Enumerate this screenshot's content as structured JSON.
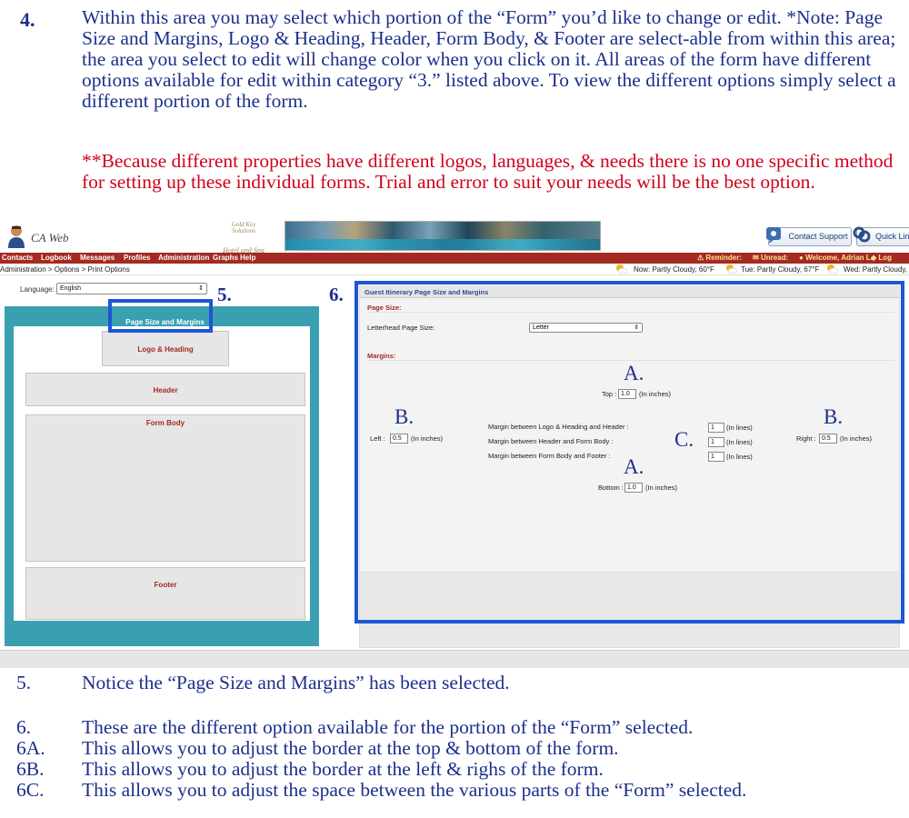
{
  "intro": {
    "step_number": "4.",
    "paragraph1": "Within this area you may select which portion of the “Form” you’d like to change or edit. *Note: Page Size and Margins, Logo & Heading, Header, Form Body, & Footer are select-able from within this area; the area you select to edit will change color when you click on it.  All areas of the form have different options available for edit within category “3.” listed above.  To view the different options simply select a different portion of the form.",
    "paragraph2": "**Because different properties have different logos, languages, & needs there is no one specific method for setting up these individual forms.  Trial and error to suit your needs will be the best option."
  },
  "app": {
    "logo_text": "CA Web",
    "hotel_logo_line1": "Gold Key Solutions",
    "hotel_logo_line2": "Hotel and Spa",
    "contact_support": "Contact Support",
    "quick_links": "Quick Link",
    "menu": [
      "Contacts",
      "Logbook",
      "Messages",
      "Profiles",
      "Administration",
      "Graphs",
      "Help"
    ],
    "reminder": "Reminder:",
    "unread": "Unread:",
    "welcome": "Welcome, Adrian L.",
    "logout": "Log",
    "breadcrumb": "Administration > Options > Print Options",
    "weather": [
      "Now: Partly Cloudy, 60°F",
      "Tue: Partly Cloudy, 67°F",
      "Wed: Partly Cloudy,"
    ],
    "language_label": "Language:",
    "language_value": "English",
    "form_sections": {
      "page_size": "Page Size and Margins",
      "logo": "Logo & Heading",
      "header": "Header",
      "body": "Form Body",
      "footer": "Footer"
    },
    "panel": {
      "title": "Guest Itinerary Page Size and Margins",
      "page_size_heading": "Page Size:",
      "letterhead_label": "Letterhead Page Size:",
      "letterhead_value": "Letter",
      "margins_heading": "Margins:",
      "top_label": "Top :",
      "top_value": "1.0",
      "top_unit": "(In inches)",
      "left_label": "Left :",
      "left_value": "0.5",
      "left_unit": "(In inches)",
      "right_label": "Right :",
      "right_value": "0.5",
      "right_unit": "(In inches)",
      "bottom_label": "Bottom :",
      "bottom_value": "1.0",
      "bottom_unit": "(In inches)",
      "between_logo_header": "Margin between Logo & Heading and Header :",
      "between_header_body": "Margin between Header and Form Body :",
      "between_body_footer": "Margin between Form Body and Footer :",
      "between_value_1": "1",
      "between_value_2": "1",
      "between_value_3": "1",
      "lines_unit": "(In lines)"
    },
    "callouts": {
      "five": "5.",
      "six": "6.",
      "a_top": "A.",
      "a_bottom": "A.",
      "b_left": "B.",
      "b_right": "B.",
      "c": "C."
    }
  },
  "notes": [
    {
      "n": "5.",
      "t": "Notice the “Page Size and Margins” has been selected."
    },
    {
      "n": "6.",
      "t": "These are the different option available for the portion of the “Form” selected."
    },
    {
      "n": "6A.",
      "t": "This allows you to adjust the border at the top & bottom of the form."
    },
    {
      "n": "6B.",
      "t": "This allows you to adjust the border at the left & righs of the form."
    },
    {
      "n": "6C.",
      "t": "This allows you to adjust the space between the various parts of the “Form” selected."
    }
  ],
  "colors": {
    "instruction_blue": "#1c2f8c",
    "instruction_red": "#d0021b",
    "menu_red": "#a42a22",
    "teal": "#3a9fb1",
    "callout_blue": "#1b56d6"
  }
}
